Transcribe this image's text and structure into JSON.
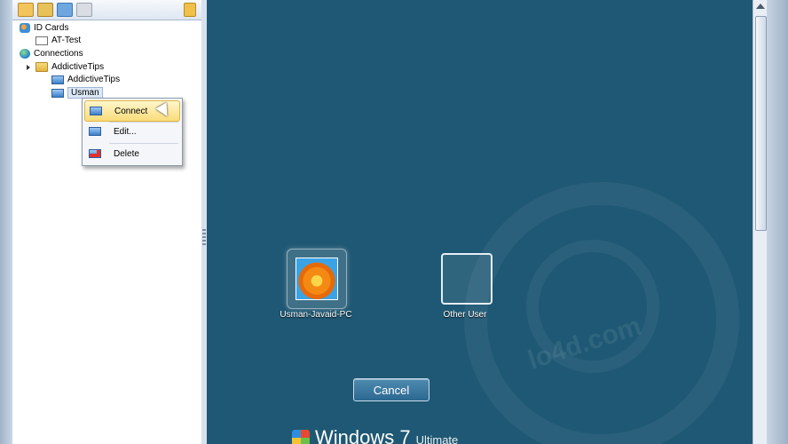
{
  "tree": {
    "id_cards": "ID Cards",
    "at_test": "AT-Test",
    "connections": "Connections",
    "addictive_folder": "AddictiveTips",
    "addictive_item": "AddictiveTips",
    "usman": "Usman"
  },
  "context_menu": {
    "connect": "Connect",
    "edit": "Edit...",
    "delete": "Delete"
  },
  "remote_session": {
    "user_tile_label": "Usman-Javaid-PC",
    "other_tile_label": "Other User",
    "cancel_label": "Cancel",
    "os_name": "Windows 7",
    "os_edition": "Ultimate",
    "watermark": "lo4d.com"
  },
  "colors": {
    "remote_bg": "#1f5874",
    "highlight": "#f9dc79"
  }
}
